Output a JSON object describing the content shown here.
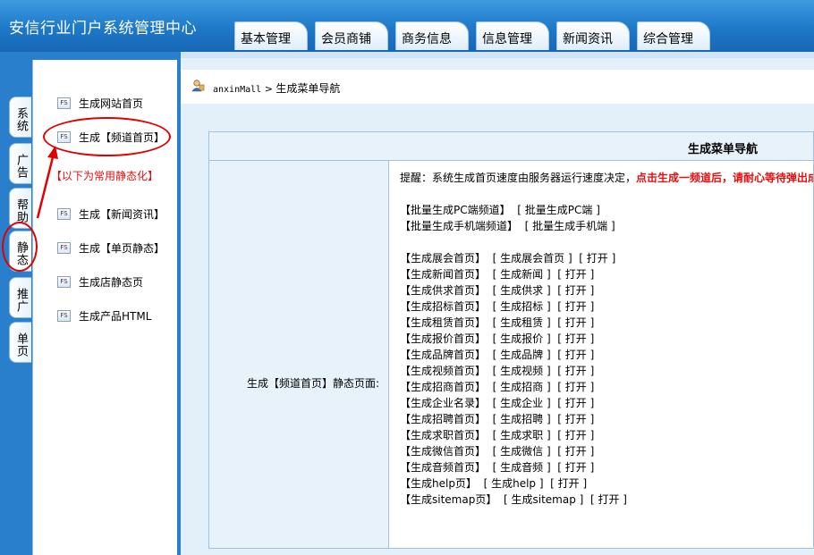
{
  "header": {
    "title": "安信行业门户系统管理中心",
    "tabs": [
      "基本管理",
      "会员商铺",
      "商务信息",
      "信息管理",
      "新闻资讯",
      "综合管理"
    ]
  },
  "side_tabs": [
    "系统",
    "广告",
    "帮助",
    "静态",
    "推广",
    "单页"
  ],
  "menu": {
    "icon_text": "FS",
    "items": [
      "生成网站首页",
      "生成【频道首页】",
      "生成【新闻资讯】",
      "生成【单页静态】",
      "生成店静态页",
      "生成产品HTML"
    ],
    "note": "【以下为常用静态化】"
  },
  "breadcrumb": {
    "root": "anxinMall",
    "separator": ">",
    "current": "生成菜单导航"
  },
  "panel": {
    "title": "生成菜单导航",
    "row_label": "生成【频道首页】静态页面:",
    "tip_prefix": "提醒：系统生成首页速度由服务器运行速度决定，",
    "tip_emphasis": "点击生成一频道后，请耐心等待弹出成",
    "batch": [
      {
        "label": "【批量生成PC端频道】",
        "action": "[ 批量生成PC端 ]"
      },
      {
        "label": "【批量生成手机端频道】",
        "action": "[ 批量生成手机端 ]"
      }
    ],
    "channels": [
      {
        "label": "【生成展会首页】",
        "action": "[ 生成展会首页 ]",
        "open": "[ 打开 ]"
      },
      {
        "label": "【生成新闻首页】",
        "action": "[ 生成新闻 ]",
        "open": "[ 打开 ]"
      },
      {
        "label": "【生成供求首页】",
        "action": "[ 生成供求 ]",
        "open": "[ 打开 ]"
      },
      {
        "label": "【生成招标首页】",
        "action": "[ 生成招标 ]",
        "open": "[ 打开 ]"
      },
      {
        "label": "【生成租赁首页】",
        "action": "[ 生成租赁 ]",
        "open": "[ 打开 ]"
      },
      {
        "label": "【生成报价首页】",
        "action": "[ 生成报价 ]",
        "open": "[ 打开 ]"
      },
      {
        "label": "【生成品牌首页】",
        "action": "[ 生成品牌 ]",
        "open": "[ 打开 ]"
      },
      {
        "label": "【生成视频首页】",
        "action": "[ 生成视频 ]",
        "open": "[ 打开 ]"
      },
      {
        "label": "【生成招商首页】",
        "action": "[ 生成招商 ]",
        "open": "[ 打开 ]"
      },
      {
        "label": "【生成企业名录】",
        "action": "[ 生成企业 ]",
        "open": "[ 打开 ]"
      },
      {
        "label": "【生成招聘首页】",
        "action": "[ 生成招聘 ]",
        "open": "[ 打开 ]"
      },
      {
        "label": "【生成求职首页】",
        "action": "[ 生成求职 ]",
        "open": "[ 打开 ]"
      },
      {
        "label": "【生成微信首页】",
        "action": "[ 生成微信 ]",
        "open": "[ 打开 ]"
      },
      {
        "label": "【生成音频首页】",
        "action": "[ 生成音频 ]",
        "open": "[ 打开 ]"
      },
      {
        "label": "【生成help页】",
        "action": "[ 生成help ]",
        "open": "[ 打开 ]"
      },
      {
        "label": "【生成sitemap页】",
        "action": "[ 生成sitemap ]",
        "open": "[ 打开 ]"
      }
    ]
  }
}
